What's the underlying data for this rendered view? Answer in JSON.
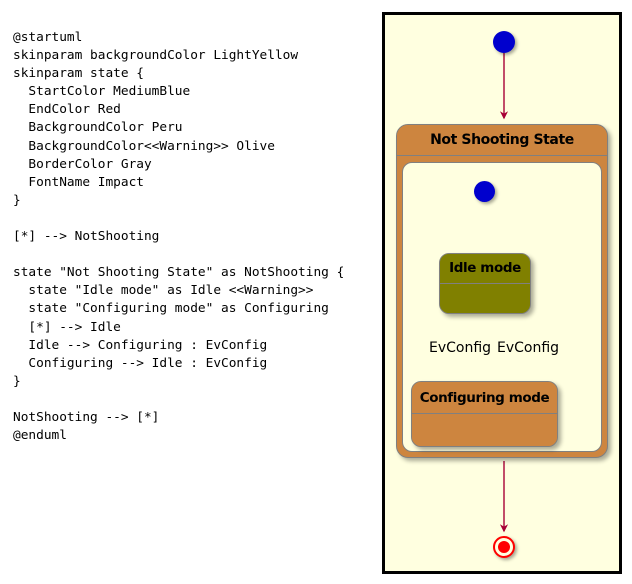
{
  "source": {
    "language": "plantuml",
    "code": "@startuml\nskinparam backgroundColor LightYellow\nskinparam state {\n  StartColor MediumBlue\n  EndColor Red\n  BackgroundColor Peru\n  BackgroundColor<<Warning>> Olive\n  BorderColor Gray\n  FontName Impact\n}\n\n[*] --> NotShooting\n\nstate \"Not Shooting State\" as NotShooting {\n  state \"Idle mode\" as Idle <<Warning>>\n  state \"Configuring mode\" as Configuring\n  [*] --> Idle\n  Idle --> Configuring : EvConfig\n  Configuring --> Idle : EvConfig\n}\n\nNotShooting --> [*]\n@enduml"
  },
  "diagram": {
    "type": "state-machine",
    "background_color": "#FFFFE0",
    "border_color": "#000000",
    "composite_state": {
      "label": "Not Shooting State",
      "background_color": "#CD853F",
      "border_color": "#808080",
      "inner_background_color": "#FFFFE0"
    },
    "states": [
      {
        "id": "idle",
        "label": "Idle mode",
        "stereotype": "Warning",
        "background_color": "#808000",
        "border_color": "#808080"
      },
      {
        "id": "configuring",
        "label": "Configuring mode",
        "stereotype": "",
        "background_color": "#CD853F",
        "border_color": "#808080"
      }
    ],
    "nodes": {
      "start_outer": {
        "name": "initial-state",
        "color": "#0000CD"
      },
      "start_inner": {
        "name": "initial-state",
        "color": "#0000CD"
      },
      "end": {
        "name": "final-state",
        "color": "#FF0000"
      }
    },
    "transitions": [
      {
        "from": "[*]",
        "to": "NotShooting",
        "label": ""
      },
      {
        "from": "[*]",
        "to": "Idle",
        "label": ""
      },
      {
        "from": "Idle",
        "to": "Configuring",
        "label": "EvConfig"
      },
      {
        "from": "Configuring",
        "to": "Idle",
        "label": "EvConfig"
      },
      {
        "from": "NotShooting",
        "to": "[*]",
        "label": ""
      }
    ],
    "edge_color": "#A80036",
    "labels": {
      "idle_to_configuring": "EvConfig",
      "configuring_to_idle": "EvConfig"
    }
  }
}
